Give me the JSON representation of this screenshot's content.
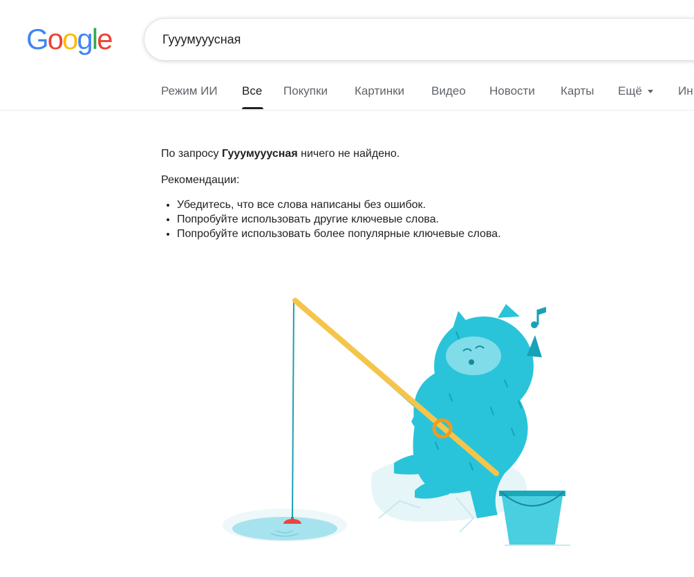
{
  "logo": {
    "letters": [
      "G",
      "o",
      "o",
      "g",
      "l",
      "e"
    ],
    "colors": [
      "#4285F4",
      "#EA4335",
      "#FBBC05",
      "#4285F4",
      "#34A853",
      "#EA4335"
    ]
  },
  "search": {
    "value": "Гууумууусная"
  },
  "tabs": [
    {
      "label": "Режим ИИ"
    },
    {
      "label": "Все"
    },
    {
      "label": "Покупки"
    },
    {
      "label": "Картинки"
    },
    {
      "label": "Видео"
    },
    {
      "label": "Новости"
    },
    {
      "label": "Карты"
    },
    {
      "label": "Ещё"
    },
    {
      "label": "Ин"
    }
  ],
  "active_tab": "Все",
  "results": {
    "message_prefix": "По запросу",
    "query": "Гууумууусная",
    "message_suffix": "ничего не найдено.",
    "recommendations_title": "Рекомендации:",
    "recommendations": [
      "Убедитесь, что все слова написаны без ошибок.",
      "Попробуйте использовать другие ключевые слова.",
      "Попробуйте использовать более популярные ключевые слова."
    ]
  },
  "colors": {
    "fur": "#29C4D9",
    "fur_dark": "#17A2B8",
    "rod": "#F5C54B",
    "bobber": "#E8453C",
    "ice": "#E0F4F8",
    "water": "#A7E3EE"
  }
}
